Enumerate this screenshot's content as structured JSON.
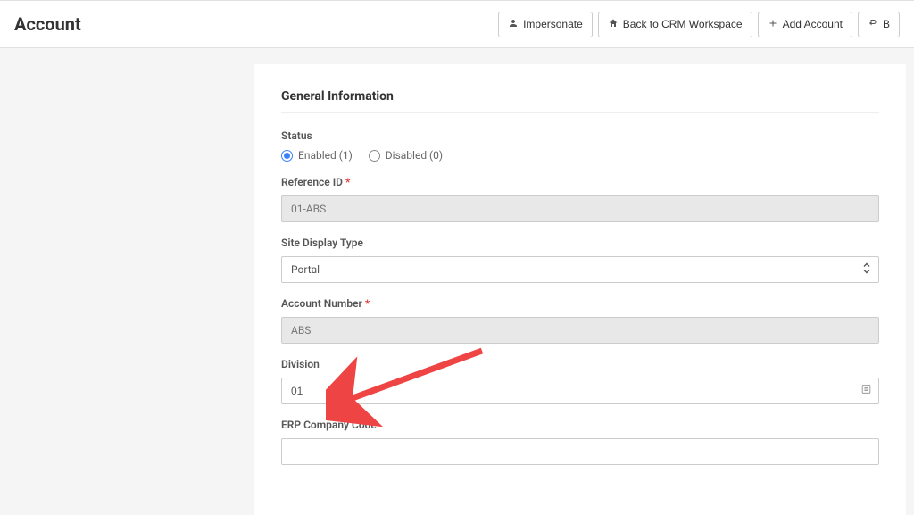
{
  "header": {
    "title": "Account",
    "actions": {
      "impersonate": "Impersonate",
      "back_crm": "Back to CRM Workspace",
      "add_account": "Add Account",
      "back_partial": "B"
    }
  },
  "form": {
    "section_title": "General Information",
    "status": {
      "label": "Status",
      "enabled_label": "Enabled (1)",
      "disabled_label": "Disabled (0)"
    },
    "reference_id": {
      "label": "Reference ID",
      "value": "01-ABS"
    },
    "site_display_type": {
      "label": "Site Display Type",
      "value": "Portal"
    },
    "account_number": {
      "label": "Account Number",
      "value": "ABS"
    },
    "division": {
      "label": "Division",
      "value": "01"
    },
    "erp_company_code": {
      "label": "ERP Company Code",
      "value": ""
    }
  }
}
